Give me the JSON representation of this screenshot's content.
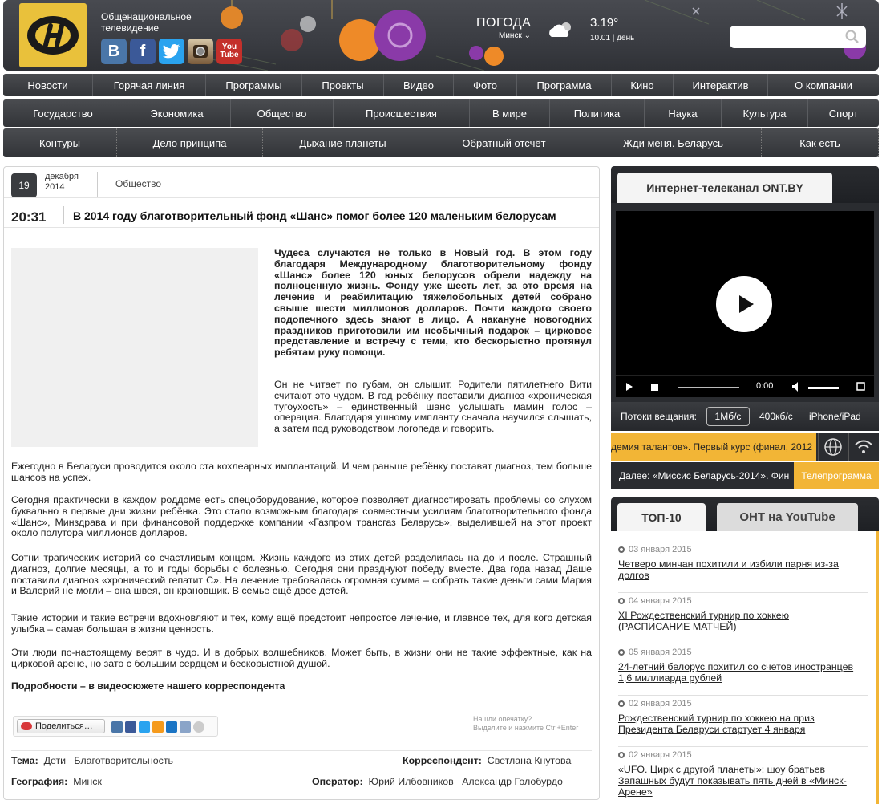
{
  "brand": {
    "line1": "Общенациональное",
    "line2": "телевидение"
  },
  "social": [
    {
      "name": "vkontakte",
      "label": "В",
      "color": "#4a76a8"
    },
    {
      "name": "facebook",
      "label": "f",
      "color": "#3b5998"
    },
    {
      "name": "twitter",
      "label": "t",
      "color": "#2aa3ef"
    },
    {
      "name": "instagram",
      "label": "",
      "color": "#8a6a4a"
    },
    {
      "name": "youtube",
      "label": "You Tube",
      "color": "#c4302b"
    }
  ],
  "weather": {
    "title": "ПОГОДА",
    "city": "Минск",
    "temp": "3.19°",
    "date": "10.01",
    "period": "день"
  },
  "search": {
    "placeholder": ""
  },
  "nav1": [
    "Новости",
    "Горячая линия",
    "Программы",
    "Проекты",
    "Видео",
    "Фото",
    "Программа",
    "Кино",
    "Интерактив",
    "О компании"
  ],
  "nav2": [
    "Государство",
    "Экономика",
    "Общество",
    "Происшествия",
    "В мире",
    "Политика",
    "Наука",
    "Культура",
    "Спорт"
  ],
  "nav3": [
    "Контуры",
    "Дело принципа",
    "Дыхание планеты",
    "Обратный отсчёт",
    "Жди меня. Беларусь",
    "Как есть"
  ],
  "article": {
    "day": "19",
    "month": "декабря",
    "year": "2014",
    "rubric": "Общество",
    "time": "20:31",
    "title": "В 2014 году благотворительный фонд «Шанс» помог более 120 маленьким белорусам",
    "lead": "Чудеса случаются не только в Новый год. В этом году благодаря Международному благотворительному фонду «Шанс» более 120 юных белорусов обрели надежду на полноценную жизнь. Фонду уже шесть лет, за это время на лечение и реабилитацию тяжелобольных детей собрано свыше шести миллионов долларов. Почти каждого своего подопечного здесь знают в лицо. А накануне новогодних праздников приготовили им необычный подарок – цирковое представление и встречу с теми, кто бескорыстно протянул ребятам руку помощи.",
    "p1": "Он не читает по губам, он слышит. Родители пятилетнего Вити считают это чудом. В год ребёнку поставили диагноз «хроническая тугоухость» – единственный шанс услышать мамин голос – операция. Благодаря ушному импланту сначала научился слышать, а затем под руководством логопеда и говорить.",
    "p2": "Ежегодно в Беларуси проводится около ста кохлеарных имплантаций. И чем раньше ребёнку поставят диагноз, тем больше шансов на успех.",
    "p3": "Сегодня практически в каждом роддоме есть спецоборудование, которое позволяет диагностировать проблемы со слухом буквально в первые дни жизни ребёнка. Это стало возможным благодаря совместным усилиям благотворительного фонда «Шанс», Минздрава и при финансовой поддержке компании «Газпром трансгаз Беларусь», выделившей на этот проект около полутора миллионов долларов.",
    "p4": "Сотни трагических историй со счастливым концом. Жизнь каждого из этих детей разделилась на до и после. Страшный диагноз, долгие месяцы, а то и годы борьбы с болезнью. Сегодня они празднуют победу вместе. Два года назад Даше поставили диагноз «хронический гепатит С». На лечение требовалась огромная сумма – собрать такие деньги сами Мария и Валерий не могли – она швея, он крановщик. В семье ещё двое детей.",
    "p5": "Такие истории и такие встречи вдохновляют и тех, кому ещё предстоит непростое лечение, и главное тех, для кого детская улыбка – самая большая в жизни ценность.",
    "p6": "Эти люди по-настоящему верят в чудо. И в добрых волшебников. Может быть, в жизни они не такие эффектные, как на цирковой арене, но зато с большим сердцем и бескорыстной душой.",
    "p7": "Подробности – в видеосюжете нашего корреспондента",
    "share": "Поделиться…",
    "typo1": "Нашли опечатку?",
    "typo2": "Выделите и нажмите Ctrl+Enter",
    "theme_label": "Тема:",
    "theme1": "Дети",
    "theme2": "Благотворительность",
    "corr_label": "Корреспондент:",
    "corr": "Светлана Кнутова",
    "geo_label": "География:",
    "geo": "Минск",
    "op_label": "Оператор:",
    "op1": "Юрий Илбовников",
    "op2": "Александр Голобурдо"
  },
  "tv": {
    "tab": "Интернет-телеканал ONT.BY",
    "time": "0:00",
    "streams_label": "Потоки вещания:",
    "s1": "1Мб/с",
    "s2": "400кб/с",
    "s3": "iPhone/iPad",
    "ticker": "демия талантов». Первый курс (финал, 2012",
    "next": "Далее: «Миссис Беларусь-2014». Фин",
    "tvprog": "Телепрограмма"
  },
  "tabs": {
    "top": "ТОП-10",
    "yt": "ОНТ на YouTube"
  },
  "news": [
    {
      "date": "03 января 2015",
      "title": "Четверо минчан похитили и избили парня из-за долгов"
    },
    {
      "date": "04 января 2015",
      "title": "XI Рождественский турнир по хоккею (РАСПИСАНИЕ МАТЧЕЙ)"
    },
    {
      "date": "05 января 2015",
      "title": "24-летний белорус похитил со счетов иностранцев 1,6 миллиарда рублей"
    },
    {
      "date": "02 января 2015",
      "title": "Рождественский турнир по хоккею на приз Президента Беларуси стартует 4 января"
    },
    {
      "date": "02 января 2015",
      "title": "«UFO. Цирк с другой планеты»: шоу братьев Запашных будут показывать пять дней в «Минск-Арене»"
    }
  ]
}
